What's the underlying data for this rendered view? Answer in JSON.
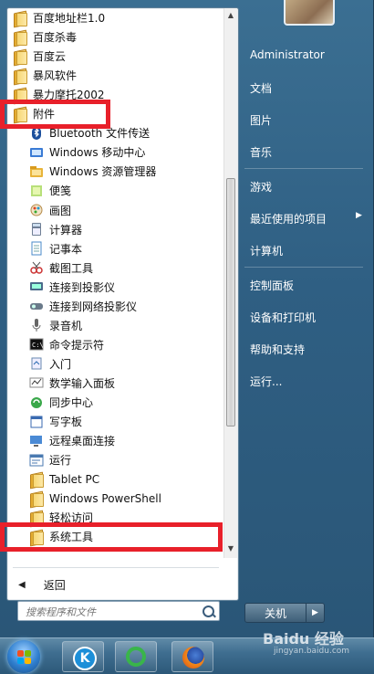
{
  "programs": [
    {
      "label": "百度地址栏1.0",
      "icon": "folder-icon",
      "indent": false
    },
    {
      "label": "百度杀毒",
      "icon": "folder-icon",
      "indent": false
    },
    {
      "label": "百度云",
      "icon": "folder-icon",
      "indent": false
    },
    {
      "label": "暴风软件",
      "icon": "folder-icon",
      "indent": false
    },
    {
      "label": "暴力摩托2002",
      "icon": "folder-icon",
      "indent": false
    },
    {
      "label": "附件",
      "icon": "folder-icon",
      "indent": false,
      "expanded": true
    },
    {
      "label": "Bluetooth 文件传送",
      "icon": "bluetooth-icon",
      "indent": true
    },
    {
      "label": "Windows 移动中心",
      "icon": "mobility-center-icon",
      "indent": true
    },
    {
      "label": "Windows 资源管理器",
      "icon": "explorer-icon",
      "indent": true
    },
    {
      "label": "便笺",
      "icon": "sticky-notes-icon",
      "indent": true
    },
    {
      "label": "画图",
      "icon": "paint-icon",
      "indent": true
    },
    {
      "label": "计算器",
      "icon": "calculator-icon",
      "indent": true
    },
    {
      "label": "记事本",
      "icon": "notepad-icon",
      "indent": true
    },
    {
      "label": "截图工具",
      "icon": "snipping-tool-icon",
      "indent": true
    },
    {
      "label": "连接到投影仪",
      "icon": "projector-icon",
      "indent": true
    },
    {
      "label": "连接到网络投影仪",
      "icon": "network-projector-icon",
      "indent": true
    },
    {
      "label": "录音机",
      "icon": "microphone-icon",
      "indent": true
    },
    {
      "label": "命令提示符",
      "icon": "cmd-icon",
      "indent": true
    },
    {
      "label": "入门",
      "icon": "getting-started-icon",
      "indent": true
    },
    {
      "label": "数学输入面板",
      "icon": "math-input-icon",
      "indent": true
    },
    {
      "label": "同步中心",
      "icon": "sync-center-icon",
      "indent": true
    },
    {
      "label": "写字板",
      "icon": "wordpad-icon",
      "indent": true
    },
    {
      "label": "远程桌面连接",
      "icon": "remote-desktop-icon",
      "indent": true
    },
    {
      "label": "运行",
      "icon": "run-icon",
      "indent": true
    },
    {
      "label": "Tablet PC",
      "icon": "folder-icon",
      "indent": true
    },
    {
      "label": "Windows PowerShell",
      "icon": "folder-icon",
      "indent": true
    },
    {
      "label": "轻松访问",
      "icon": "folder-icon",
      "indent": true
    },
    {
      "label": "系统工具",
      "icon": "folder-icon",
      "indent": true
    }
  ],
  "back_label": "返回",
  "search": {
    "placeholder": "搜索程序和文件"
  },
  "right_menu": {
    "user": "Administrator",
    "documents": "文档",
    "pictures": "图片",
    "music": "音乐",
    "games": "游戏",
    "recent_items": "最近使用的项目",
    "computer": "计算机",
    "control_panel": "控制面板",
    "devices_printers": "设备和打印机",
    "help_support": "帮助和支持",
    "run": "运行..."
  },
  "shutdown_label": "关机",
  "watermark": {
    "text": "Baidu 经验",
    "sub": "jingyan.baidu.com"
  },
  "colors": {
    "highlight": "#e8202a",
    "accent": "#2f5f83"
  }
}
